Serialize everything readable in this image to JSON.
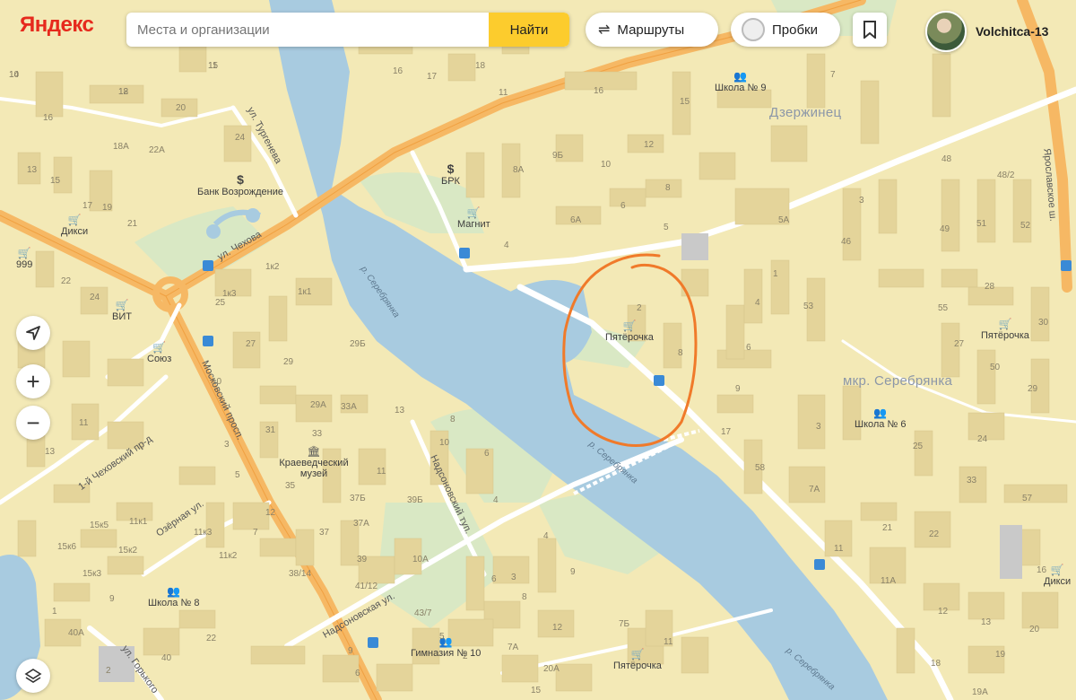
{
  "header": {
    "logo_text": "Яндекс",
    "search_placeholder": "Места и организации",
    "search_button": "Найти",
    "routes_label": "Маршруты",
    "traffic_label": "Пробки",
    "bookmark_icon": "bookmark-icon",
    "user_name": "Volchitca-13"
  },
  "controls": {
    "locate_icon": "navigation-arrow-icon",
    "zoom_in": "+",
    "zoom_out": "−",
    "layers_icon": "layers-icon"
  },
  "districts": [
    "Дзержинец",
    "мкр. Серебрянка"
  ],
  "streets": [
    "ул. Тургенева",
    "ул. Чехова",
    "Московский просп.",
    "Ярославское ш.",
    "1-й Чеховский пр-д",
    "Озёрная ул.",
    "Надсоновский туп.",
    "Надсоновская ул.",
    "ул. Горького"
  ],
  "river": [
    "р. Серебрянка",
    "р. Серебрянка",
    "р. Серебрянка"
  ],
  "pois": [
    "Банк Возрождение",
    "БРК",
    "Магнит",
    "Дикси",
    "999",
    "ВИТ",
    "Союз",
    "Краеведческий музей",
    "Пятёрочка",
    "Школа № 9",
    "Пятёрочка",
    "Школа № 6",
    "Школа № 8",
    "Гимназия № 10",
    "Пятёрочка",
    "Дикси"
  ],
  "house_numbers": [
    "15",
    "14",
    "18",
    "16",
    "20",
    "24",
    "18А",
    "22А",
    "13",
    "15",
    "17",
    "19",
    "21",
    "22",
    "24",
    "1к2",
    "1к3",
    "1к1",
    "25",
    "27",
    "29Б",
    "29",
    "29А",
    "33А",
    "31",
    "33",
    "13",
    "8",
    "10",
    "6",
    "4",
    "35",
    "37Б",
    "37А",
    "37",
    "39",
    "41/12",
    "43/7",
    "10А",
    "11",
    "39Б",
    "12",
    "38/14",
    "11к2",
    "11к3",
    "11к1",
    "15к5",
    "15к6",
    "15к2",
    "15к3",
    "9",
    "11",
    "13",
    "16",
    "17",
    "18",
    "16",
    "11",
    "15",
    "12",
    "10",
    "9Б",
    "8А",
    "8",
    "7",
    "6",
    "6А",
    "5",
    "4",
    "5А",
    "3",
    "46",
    "48",
    "48/2",
    "49",
    "51",
    "52",
    "53",
    "28",
    "55",
    "27",
    "50",
    "29",
    "30",
    "24",
    "25",
    "33",
    "57",
    "21",
    "22",
    "11",
    "11А",
    "12",
    "13",
    "20",
    "19",
    "18",
    "19А",
    "16",
    "17",
    "58",
    "7А",
    "8",
    "9",
    "6",
    "4",
    "3",
    "2",
    "1",
    "10",
    "3",
    "5",
    "7",
    "9",
    "6",
    "2",
    "1",
    "40А",
    "40",
    "22",
    "20А",
    "12",
    "7Б",
    "7А",
    "15",
    "11",
    "9",
    "8",
    "6",
    "4",
    "3",
    "5",
    "2",
    "11",
    "10",
    "12"
  ],
  "route_stops": 7,
  "annotation": {
    "shape": "hand-drawn circle",
    "color": "#f07a2a"
  }
}
